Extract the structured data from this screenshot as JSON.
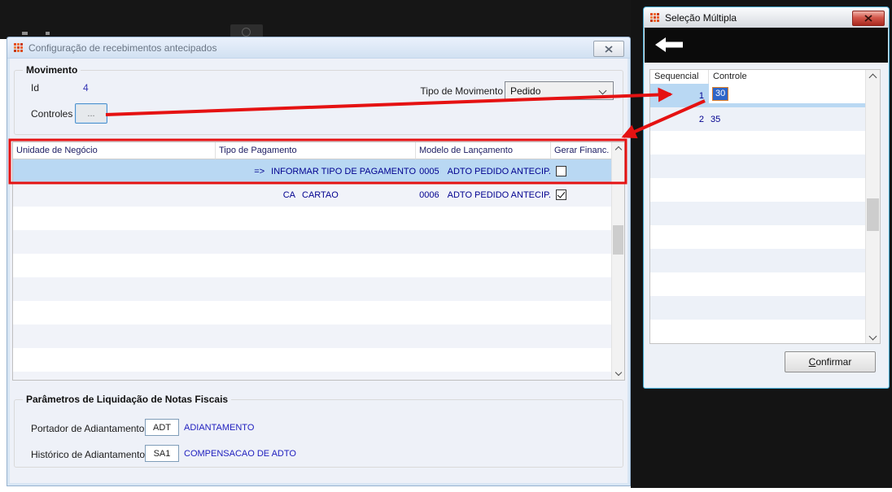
{
  "main_dialog": {
    "title": "Configuração de recebimentos antecipados",
    "movimento": {
      "legend": "Movimento",
      "id_label": "Id",
      "id_value": "4",
      "controles_label": "Controles",
      "controles_button": "...",
      "tipo_label": "Tipo de Movimento",
      "tipo_value": "Pedido"
    },
    "table": {
      "columns": [
        "Unidade de Negócio",
        "Tipo de Pagamento",
        "Modelo de Lançamento",
        "Gerar Financ."
      ],
      "rows": [
        {
          "unidade": "",
          "pagamento_code": "=>",
          "pagamento_desc": "INFORMAR TIPO DE PAGAMENTO",
          "modelo_code": "0005",
          "modelo_desc": "ADTO PEDIDO ANTECIP.",
          "gerar_financ": false,
          "selected": true
        },
        {
          "unidade": "",
          "pagamento_code": "CA",
          "pagamento_desc": "CARTAO",
          "modelo_code": "0006",
          "modelo_desc": "ADTO PEDIDO ANTECIP.",
          "gerar_financ": true,
          "selected": false
        }
      ]
    },
    "parametros": {
      "legend": "Parâmetros de Liquidação de Notas Fiscais",
      "portador_label": "Portador de Adiantamento",
      "portador_code": "ADT",
      "portador_desc": "ADIANTAMENTO",
      "historico_label": "Histórico de Adiantamento",
      "historico_code": "SA1",
      "historico_desc": "COMPENSACAO DE ADTO"
    }
  },
  "selection_dialog": {
    "title": "Seleção Múltipla",
    "columns": [
      "Sequencial",
      "Controle"
    ],
    "rows": [
      {
        "sequencial": "1",
        "controle": "30",
        "selected": true,
        "editing": true
      },
      {
        "sequencial": "2",
        "controle": "35",
        "selected": false,
        "editing": false
      }
    ],
    "confirm_button": "Confirmar"
  },
  "icons": {
    "app_icon": "totvs-mosaic",
    "close": "x-glyph",
    "back": "left-arrow",
    "dropdown": "chevron-down",
    "scroll_up": "chevron-up",
    "scroll_down": "chevron-down"
  },
  "colors": {
    "annotation_red": "#e51212",
    "selection_blue": "#b9d8f3",
    "edit_selection_blue": "#2e66c9",
    "edit_border_orange": "#e07f28",
    "table_text_navy": "#00008f",
    "link_blue": "#1d1dbe",
    "window_black": "#161616",
    "dialog_bg": "#eef1f8"
  }
}
